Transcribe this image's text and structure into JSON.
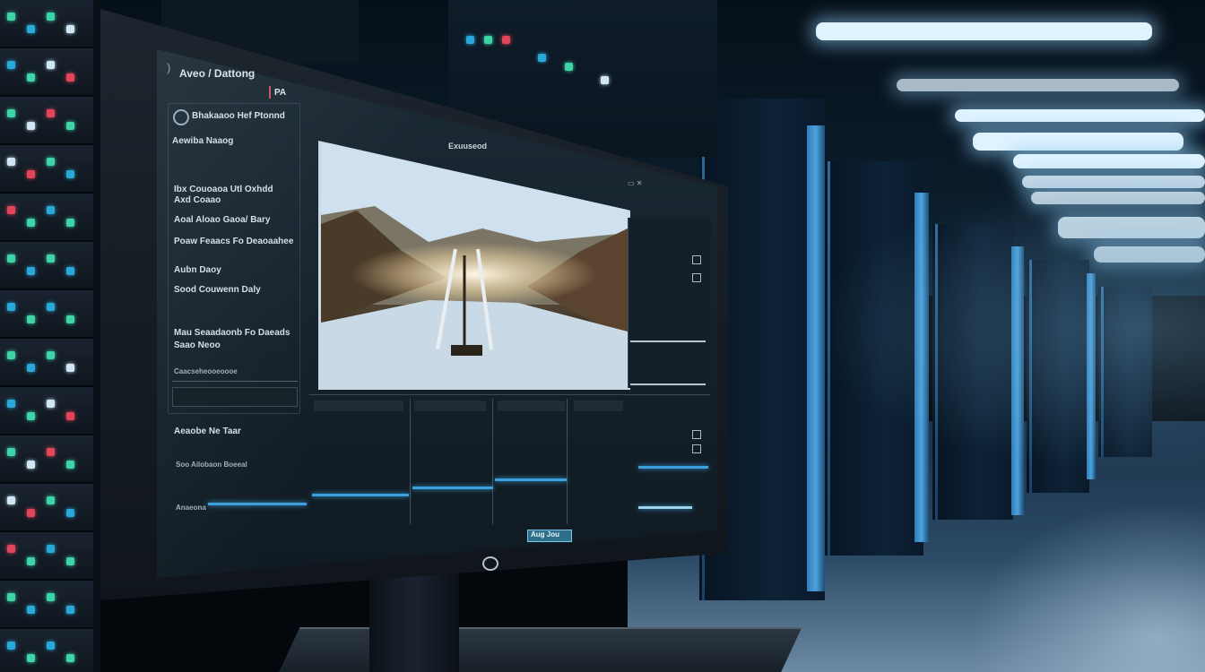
{
  "screen": {
    "title": "Aveo / Dattong",
    "tab": "PA",
    "viewer_title": "Exuuseod",
    "status_pill": "Aug Jou"
  },
  "sidebar": {
    "header": "Bhakaaoo Hef Ptonnd",
    "subheader": "Aewiba Naaog",
    "items": [
      "Ibx Couoaoa Utl Oxhdd",
      "Axd Coaao",
      "Aoal Aloao Gaoa/ Bary",
      "Poaw Feaacs Fo Deaoaahee",
      "Aubn Daoy",
      "Sood Couwenn Daly",
      "Mau Seaadaonb Fo Daeads",
      "Saao Neoo"
    ],
    "footer_small": "Caacseheooeoooe"
  },
  "timeline": {
    "label_1": "Aeaobe Ne Taar",
    "label_2": "Soo Ailobaon Boeeal",
    "label_3": "Anaeona"
  },
  "colors": {
    "accent_blue": "#3ca0dc",
    "led_green": "#3fd4a8",
    "led_red": "#e2455a",
    "screen_bg": "#14202a"
  }
}
